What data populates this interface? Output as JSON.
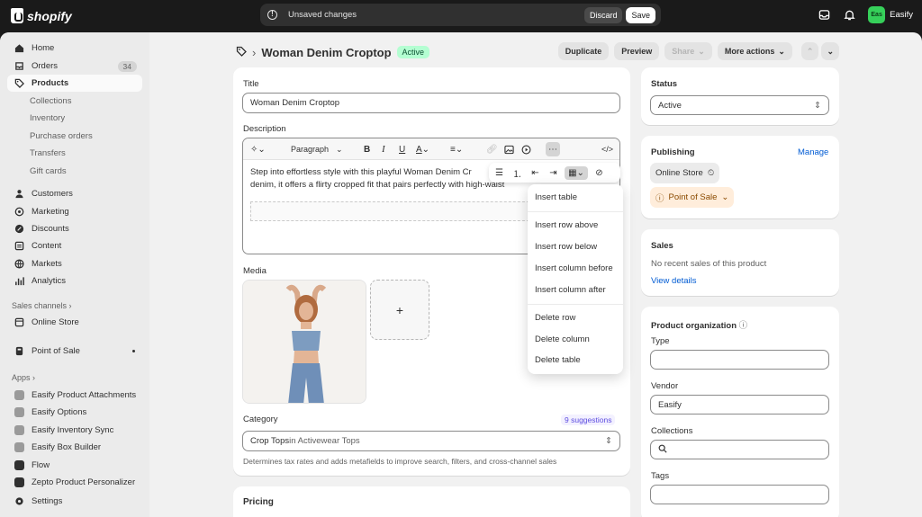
{
  "topbar": {
    "brand": "shopify",
    "unsaved_text": "Unsaved changes",
    "discard_label": "Discard",
    "save_label": "Save",
    "store_initials": "Eas",
    "store_name": "Easify"
  },
  "sidebar": {
    "items": [
      {
        "label": "Home",
        "icon": "home-icon"
      },
      {
        "label": "Orders",
        "icon": "orders-icon",
        "badge": "34"
      },
      {
        "label": "Products",
        "icon": "tag-icon"
      },
      {
        "label": "Collections"
      },
      {
        "label": "Inventory"
      },
      {
        "label": "Purchase orders"
      },
      {
        "label": "Transfers"
      },
      {
        "label": "Gift cards"
      },
      {
        "label": "Customers",
        "icon": "person-icon"
      },
      {
        "label": "Marketing",
        "icon": "target-icon"
      },
      {
        "label": "Discounts",
        "icon": "discount-icon"
      },
      {
        "label": "Content",
        "icon": "content-icon"
      },
      {
        "label": "Markets",
        "icon": "globe-icon"
      },
      {
        "label": "Analytics",
        "icon": "chart-icon"
      }
    ],
    "sales_channels_heading": "Sales channels",
    "online_store": "Online Store",
    "point_of_sale": "Point of Sale",
    "apps_heading": "Apps",
    "apps": [
      "Easify Product Attachments",
      "Easify Options",
      "Easify Inventory Sync",
      "Easify Box Builder",
      "Flow",
      "Zepto Product Personalizer"
    ],
    "settings": "Settings"
  },
  "header": {
    "title": "Woman Denim Croptop",
    "status_badge": "Active",
    "duplicate": "Duplicate",
    "preview": "Preview",
    "share": "Share",
    "more_actions": "More actions"
  },
  "product": {
    "title_label": "Title",
    "title_value": "Woman Denim Croptop",
    "description_label": "Description",
    "paragraph_select": "Paragraph",
    "description_line1": "Step into effortless style with this playful Woman Denim Cr",
    "description_line2": "denim, it offers a flirty cropped fit that pairs perfectly with high-waist",
    "media_label": "Media",
    "category_label": "Category",
    "suggestions": "9 suggestions",
    "category_value": "Crop Tops",
    "category_path": " in Activewear Tops",
    "category_help": "Determines tax rates and adds metafields to improve search, filters, and cross-channel sales",
    "pricing_label": "Pricing"
  },
  "table_menu": {
    "items": [
      "Insert table",
      "Insert row above",
      "Insert row below",
      "Insert column before",
      "Insert column after",
      "Delete row",
      "Delete column",
      "Delete table"
    ]
  },
  "status_card": {
    "label": "Status",
    "value": "Active"
  },
  "publishing": {
    "label": "Publishing",
    "manage": "Manage",
    "online_store": "Online Store",
    "point_of_sale": "Point of Sale"
  },
  "sales": {
    "label": "Sales",
    "text": "No recent sales of this product",
    "link": "View details"
  },
  "organization": {
    "label": "Product organization",
    "type_label": "Type",
    "type_value": "",
    "vendor_label": "Vendor",
    "vendor_value": "Easify",
    "collections_label": "Collections",
    "tags_label": "Tags"
  },
  "colors": {
    "accent": "#005bd3",
    "active_badge": "#b4fed2",
    "store_avatar": "#36d05a"
  }
}
